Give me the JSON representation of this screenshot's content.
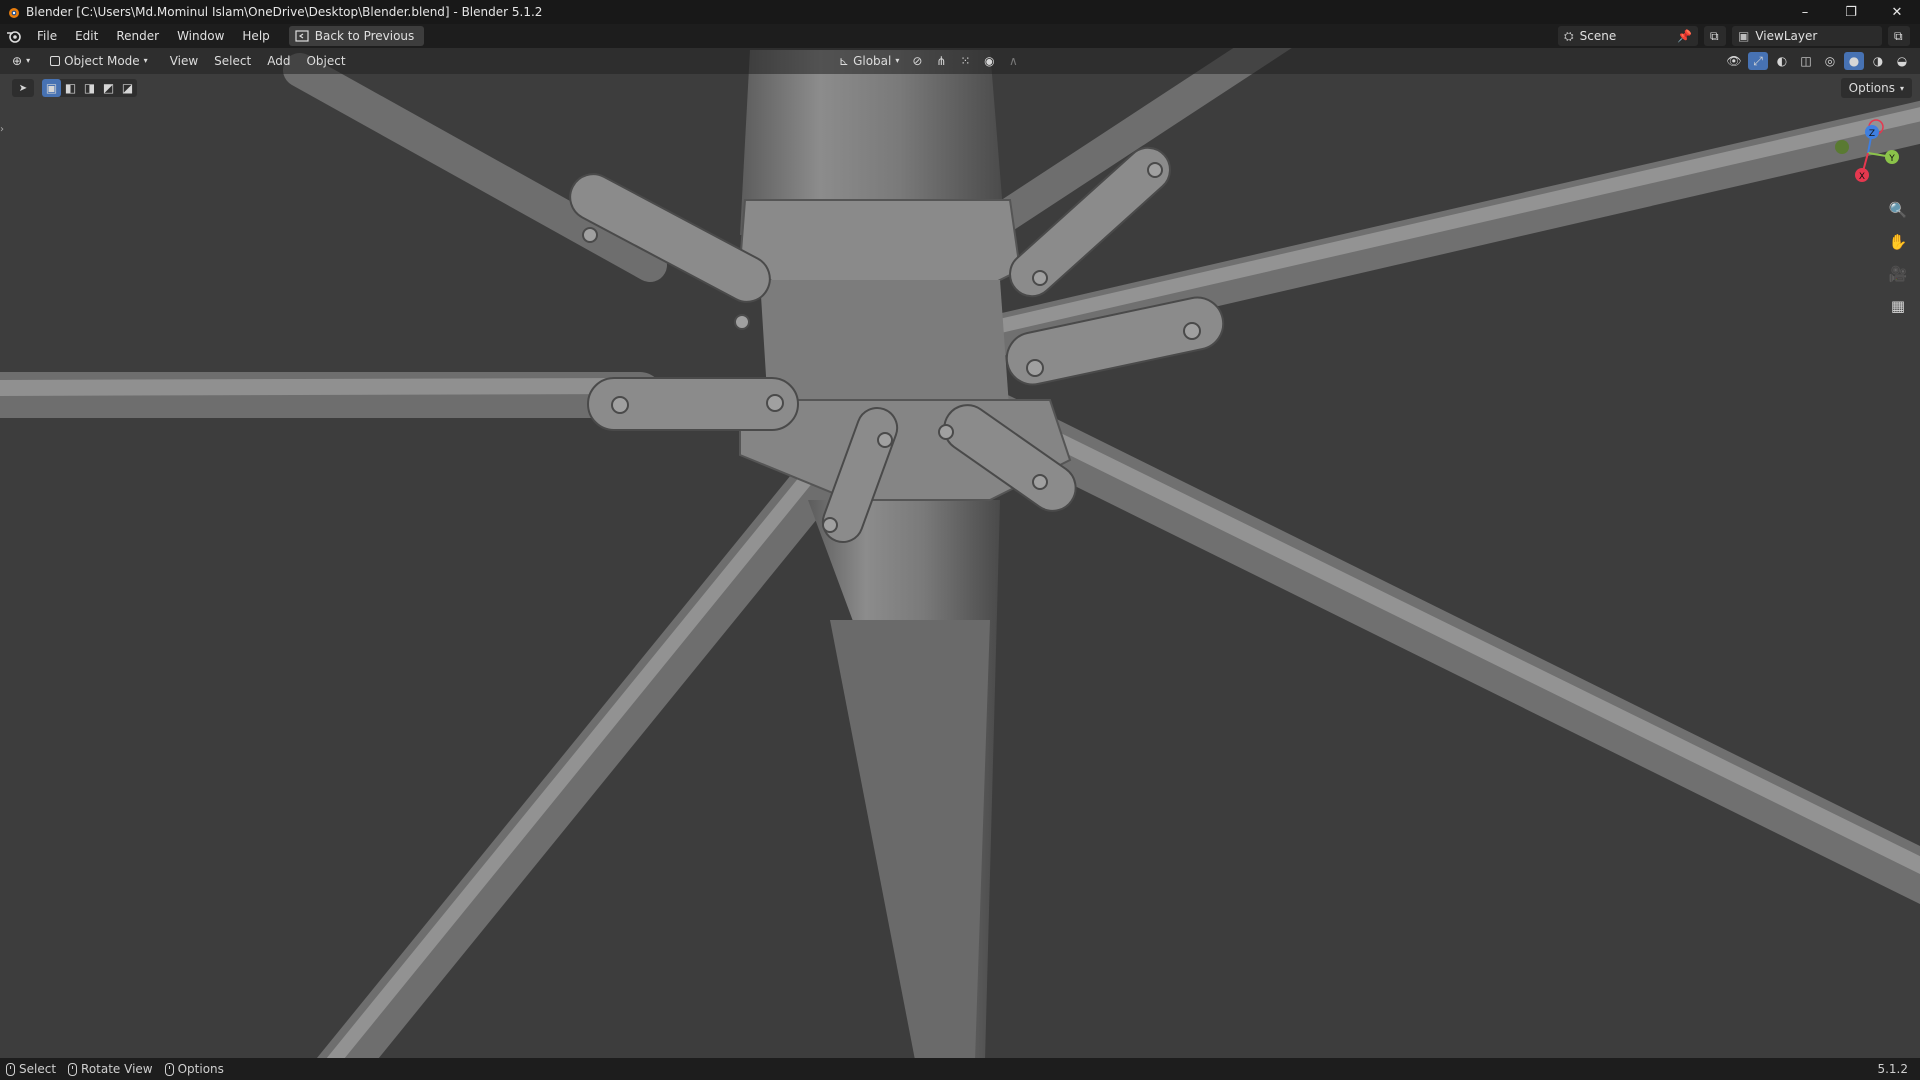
{
  "titlebar": {
    "title": "Blender [C:\\Users\\Md.Mominul Islam\\OneDrive\\Desktop\\Blender.blend] - Blender 5.1.2",
    "minimize": "–",
    "maximize": "❐",
    "close": "✕"
  },
  "menubar": {
    "items": [
      "File",
      "Edit",
      "Render",
      "Window",
      "Help"
    ],
    "back_label": "Back to Previous",
    "scene_name": "Scene",
    "view_layer": "ViewLayer"
  },
  "viewport_header": {
    "mode": "Object Mode",
    "menus": [
      "View",
      "Select",
      "Add",
      "Object"
    ],
    "transform_orientation": "Global"
  },
  "toolrow": {
    "options_label": "Options"
  },
  "gizmo": {
    "z": "Z",
    "y": "Y",
    "x": "X",
    "colors": {
      "x": "#e5384f",
      "y": "#8bc34a",
      "z": "#3f7fe0"
    }
  },
  "statusbar": {
    "select": "Select",
    "rotate": "Rotate View",
    "options": "Options",
    "version": "5.1.2"
  },
  "icons": [
    "blender-logo-icon",
    "editor-type-icon",
    "object-mode-icon",
    "transform-orientation-icon",
    "pivot-icon",
    "snap-icon",
    "proportional-icon",
    "visibility-icon",
    "gizmo-icon",
    "overlay-icon",
    "xray-icon",
    "wireframe-icon",
    "solid-icon",
    "material-icon",
    "rendered-icon",
    "zoom-icon",
    "hand-icon",
    "camera-icon",
    "grid-icon",
    "select-box-icon"
  ]
}
